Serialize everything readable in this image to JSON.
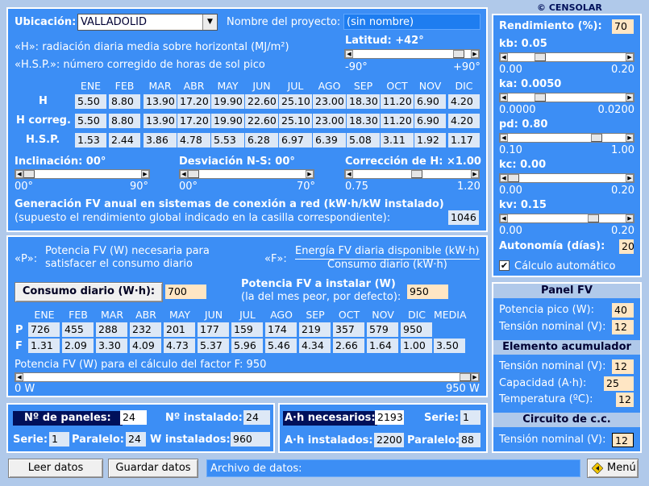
{
  "brand": "© CENSOLAR",
  "top": {
    "ubicacion_label": "Ubicación:",
    "ubicacion_value": "VALLADOLID",
    "proyecto_label": "Nombre del proyecto:",
    "proyecto_value": "(sin nombre)",
    "h_desc": "«H»: radiación diaria media sobre horizontal (MJ/m²)",
    "hsp_desc": "«H.S.P.»: número corregido de horas de sol pico",
    "latitud_label": "Latitud:  +42°",
    "lat_min": "-90°",
    "lat_max": "+90°",
    "months": [
      "ENE",
      "FEB",
      "MAR",
      "ABR",
      "MAY",
      "JUN",
      "JUL",
      "AGO",
      "SEP",
      "OCT",
      "NOV",
      "DIC"
    ],
    "rows": [
      {
        "label": "H",
        "values": [
          "5.50",
          "8.80",
          "13.90",
          "17.20",
          "19.90",
          "22.60",
          "25.10",
          "23.00",
          "18.30",
          "11.20",
          "6.90",
          "4.20"
        ]
      },
      {
        "label": "H correg.",
        "values": [
          "5.50",
          "8.80",
          "13.90",
          "17.20",
          "19.90",
          "22.60",
          "25.10",
          "23.00",
          "18.30",
          "11.20",
          "6.90",
          "4.20"
        ]
      },
      {
        "label": "H.S.P.",
        "values": [
          "1.53",
          "2.44",
          "3.86",
          "4.78",
          "5.53",
          "6.28",
          "6.97",
          "6.39",
          "5.08",
          "3.11",
          "1.92",
          "1.17"
        ]
      }
    ],
    "inclinacion_label": "Inclinación: 00°",
    "incl_min": "00°",
    "incl_max": "90°",
    "desviacion_label": "Desviación N-S: 00°",
    "desv_min": "00°",
    "desv_max": "70°",
    "correccion_label": "Corrección de H: ×1.00",
    "corr_min": "0.75",
    "corr_max": "1.20",
    "gen_title": "Generación FV anual en sistemas de conexión a red (kW·h/kW instalado)",
    "gen_sub": "(supuesto el rendimiento global indicado en la casilla correspondiente):",
    "gen_value": "1046"
  },
  "mid": {
    "p_key": "«P»:",
    "p_desc1": "Potencia FV (W) necesaria para",
    "p_desc2": "satisfacer el consumo diario",
    "f_key": "«F»:",
    "f_num": "Energía FV diaria disponible (kW·h)",
    "f_den": "Consumo diario (kW·h)",
    "consumo_button": "Consumo diario (W·h):",
    "consumo_value": "700",
    "potencia_label": "Potencia FV a instalar (W)",
    "potencia_sub": "(la del mes peor, por defecto):",
    "potencia_value": "950",
    "months": [
      "ENE",
      "FEB",
      "MAR",
      "ABR",
      "MAY",
      "JUN",
      "JUL",
      "AGO",
      "SEP",
      "OCT",
      "NOV",
      "DIC",
      "MEDIA"
    ],
    "p_label": "P",
    "p_values": [
      "726",
      "455",
      "288",
      "232",
      "201",
      "177",
      "159",
      "174",
      "219",
      "357",
      "579",
      "950"
    ],
    "f_label": "F",
    "f_values": [
      "1.31",
      "2.09",
      "3.30",
      "4.09",
      "4.73",
      "5.37",
      "5.96",
      "5.46",
      "4.34",
      "2.66",
      "1.64",
      "1.00",
      "3.50"
    ],
    "factor_label": "Potencia FV (W) para el cálculo del factor F:  950",
    "factor_min": "0 W",
    "factor_max": "950 W",
    "factor_level": 1.0
  },
  "bottom_left": {
    "paneles_label": "Nº de paneles:",
    "paneles_value": "24",
    "instalado_label": "Nº instalado:",
    "instalado_value": "24",
    "serie_label": "Serie:",
    "serie_value": "1",
    "paralelo_label": "Paralelo:",
    "paralelo_value": "24",
    "w_label": "W instalados:",
    "w_value": "960"
  },
  "bottom_right": {
    "ah_label": "A·h necesarios:",
    "ah_value": "2193",
    "serie_label": "Serie:",
    "serie_value": "1",
    "ahi_label": "A·h instalados:",
    "ahi_value": "2200",
    "paralelo_label": "Paralelo:",
    "paralelo_value": "88"
  },
  "right": {
    "rend_label": "Rendimiento (%):",
    "rend_value": "70",
    "sliders": [
      {
        "label": "kb: 0.05",
        "min": "0.00",
        "max": "0.20",
        "level": 0.25
      },
      {
        "label": "ka: 0.0050",
        "min": "0.0000",
        "max": "0.0200",
        "level": 0.25
      },
      {
        "label": "pd: 0.80",
        "min": "0.10",
        "max": "1.00",
        "level": 0.78
      },
      {
        "label": "kc: 0.00",
        "min": "0.00",
        "max": "0.20",
        "level": 0.0
      },
      {
        "label": "kv: 0.15",
        "min": "0.00",
        "max": "0.20",
        "level": 0.75
      }
    ],
    "autonomia_label": "Autonomía (días):",
    "autonomia_value": "20",
    "calculo_label": "Cálculo automático",
    "panel_title": "Panel FV",
    "pico_label": "Potencia pico (W):",
    "pico_value": "40",
    "tension_label": "Tensión nominal (V):",
    "tension_value": "12",
    "acum_title": "Elemento acumulador",
    "acum_tension_label": "Tensión nominal (V):",
    "acum_tension_value": "12",
    "capacidad_label": "Capacidad (A·h):",
    "capacidad_value": "25",
    "temp_label": "Temperatura (ºC):",
    "temp_value": "12",
    "circuito_title": "Circuito de c.c.",
    "cc_tension_label": "Tensión nominal (V):",
    "cc_tension_value": "12"
  },
  "footer": {
    "leer": "Leer datos",
    "guardar": "Guardar datos",
    "archivo_label": "Archivo de datos:",
    "menu": "Menú"
  }
}
